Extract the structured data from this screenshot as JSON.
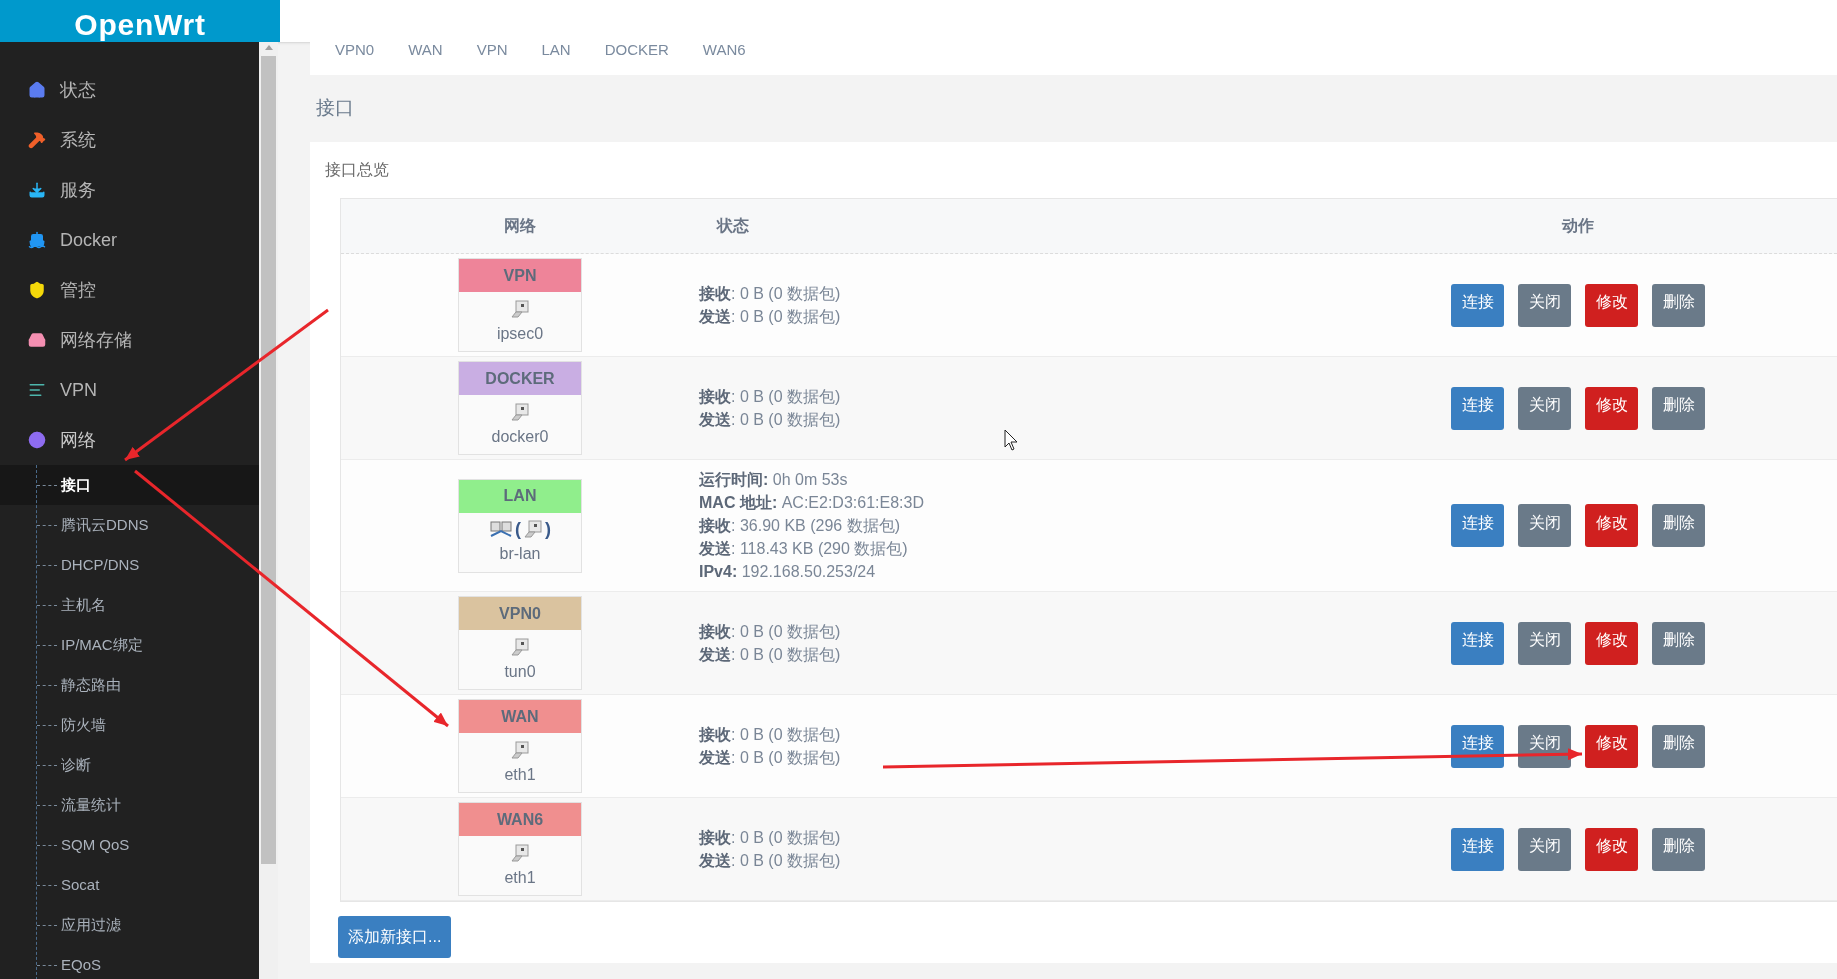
{
  "header": {
    "logo": "OpenWrt"
  },
  "sidebar": {
    "items": [
      {
        "label": "状态",
        "expanded": false
      },
      {
        "label": "系统",
        "expanded": false
      },
      {
        "label": "服务",
        "expanded": false
      },
      {
        "label": "Docker",
        "expanded": false
      },
      {
        "label": "管控",
        "expanded": false
      },
      {
        "label": "网络存储",
        "expanded": false
      },
      {
        "label": "VPN",
        "expanded": false
      },
      {
        "label": "网络",
        "expanded": true,
        "children": [
          {
            "label": "接口",
            "selected": true
          },
          {
            "label": "腾讯云DDNS",
            "selected": false
          },
          {
            "label": "DHCP/DNS",
            "selected": false
          },
          {
            "label": "主机名",
            "selected": false
          },
          {
            "label": "IP/MAC绑定",
            "selected": false
          },
          {
            "label": "静态路由",
            "selected": false
          },
          {
            "label": "防火墙",
            "selected": false
          },
          {
            "label": "诊断",
            "selected": false
          },
          {
            "label": "流量统计",
            "selected": false
          },
          {
            "label": "SQM QoS",
            "selected": false
          },
          {
            "label": "Socat",
            "selected": false
          },
          {
            "label": "应用过滤",
            "selected": false
          },
          {
            "label": "EQoS",
            "selected": false
          }
        ]
      }
    ]
  },
  "tabs": [
    "VPN0",
    "WAN",
    "VPN",
    "LAN",
    "DOCKER",
    "WAN6"
  ],
  "section_title": "接口",
  "card_title": "接口总览",
  "table": {
    "columns": [
      "网络",
      "状态",
      "动作"
    ],
    "rows": [
      {
        "name": "VPN",
        "color": "#ee8499",
        "kind": "port",
        "device": "ipsec0",
        "status": [
          "**接收**: 0 B (0 数据包)",
          "**发送**: 0 B (0 数据包)"
        ],
        "actions": [
          {
            "label": "连接",
            "kind": "primary"
          },
          {
            "label": "关闭",
            "kind": "neutral"
          },
          {
            "label": "修改",
            "kind": "danger"
          },
          {
            "label": "删除",
            "kind": "neutral"
          }
        ]
      },
      {
        "name": "DOCKER",
        "color": "#c9aee3",
        "kind": "port",
        "device": "docker0",
        "status": [
          "**接收**: 0 B (0 数据包)",
          "**发送**: 0 B (0 数据包)"
        ],
        "actions": [
          {
            "label": "连接",
            "kind": "primary"
          },
          {
            "label": "关闭",
            "kind": "neutral"
          },
          {
            "label": "修改",
            "kind": "danger"
          },
          {
            "label": "删除",
            "kind": "neutral"
          }
        ]
      },
      {
        "name": "LAN",
        "color": "#90ee8c",
        "kind": "bridge",
        "brackets": [
          "(",
          ")"
        ],
        "device": "br-lan",
        "status": [
          "**运行时间:** 0h 0m 53s",
          "**MAC 地址:** AC:E2:D3:61:E8:3D",
          "**接收**: 36.90 KB (296 数据包)",
          "**发送**: 118.43 KB (290 数据包)",
          "**IPv4:** 192.168.50.253/24"
        ],
        "actions": [
          {
            "label": "连接",
            "kind": "primary"
          },
          {
            "label": "关闭",
            "kind": "neutral"
          },
          {
            "label": "修改",
            "kind": "danger"
          },
          {
            "label": "删除",
            "kind": "neutral"
          }
        ]
      },
      {
        "name": "VPN0",
        "color": "#dac39f",
        "kind": "port",
        "device": "tun0",
        "status": [
          "**接收**: 0 B (0 数据包)",
          "**发送**: 0 B (0 数据包)"
        ],
        "actions": [
          {
            "label": "连接",
            "kind": "primary"
          },
          {
            "label": "关闭",
            "kind": "neutral"
          },
          {
            "label": "修改",
            "kind": "danger"
          },
          {
            "label": "删除",
            "kind": "neutral"
          }
        ]
      },
      {
        "name": "WAN",
        "color": "#f08f8f",
        "kind": "port",
        "device": "eth1",
        "status": [
          "**接收**: 0 B (0 数据包)",
          "**发送**: 0 B (0 数据包)"
        ],
        "actions": [
          {
            "label": "连接",
            "kind": "primary"
          },
          {
            "label": "关闭",
            "kind": "neutral"
          },
          {
            "label": "修改",
            "kind": "danger"
          },
          {
            "label": "删除",
            "kind": "neutral"
          }
        ]
      },
      {
        "name": "WAN6",
        "color": "#f08f8f",
        "kind": "port",
        "device": "eth1",
        "status": [
          "**接收**: 0 B (0 数据包)",
          "**发送**: 0 B (0 数据包)"
        ],
        "actions": [
          {
            "label": "连接",
            "kind": "primary"
          },
          {
            "label": "关闭",
            "kind": "neutral"
          },
          {
            "label": "修改",
            "kind": "danger"
          },
          {
            "label": "删除",
            "kind": "neutral"
          }
        ]
      }
    ]
  },
  "add_button": "添加新接口..."
}
